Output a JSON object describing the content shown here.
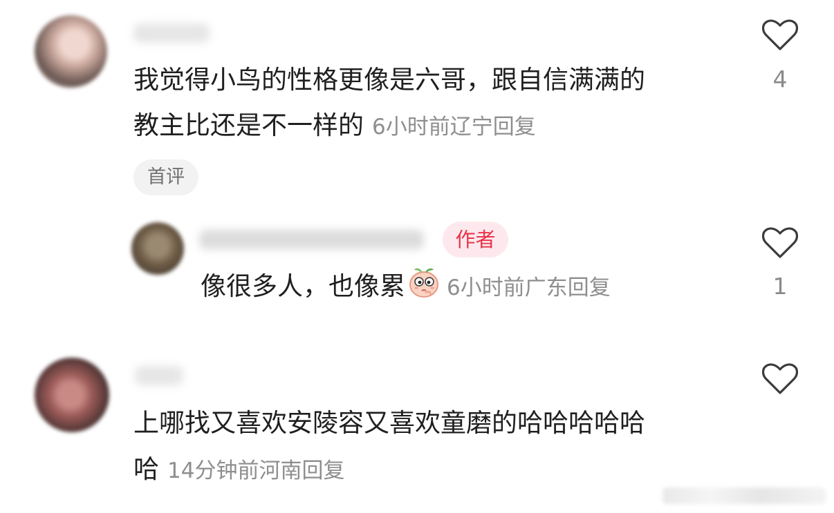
{
  "comments": [
    {
      "line1": "我觉得小鸟的性格更像是六哥，跟自信满满的",
      "line2": "教主比还是不一样的",
      "time": "6小时前",
      "location": "辽宁",
      "reply_label": "回复",
      "tag": "首评",
      "likes": "4",
      "reply": {
        "author_badge": "作者",
        "text": "像很多人，也像累",
        "emoji": "peach-emoji",
        "time": "6小时前",
        "location": "广东",
        "reply_label": "回复",
        "likes": "1"
      }
    },
    {
      "line1": "上哪找又喜欢安陵容又喜欢童磨的哈哈哈哈哈",
      "line2": "哈",
      "time": "14分钟前",
      "location": "河南",
      "reply_label": "回复",
      "likes": ""
    }
  ],
  "icons": {
    "like": "heart-outline-icon"
  },
  "colors": {
    "author_badge_text": "#e8334a",
    "author_badge_bg": "#fde9ed",
    "meta": "#8e8e8e"
  }
}
